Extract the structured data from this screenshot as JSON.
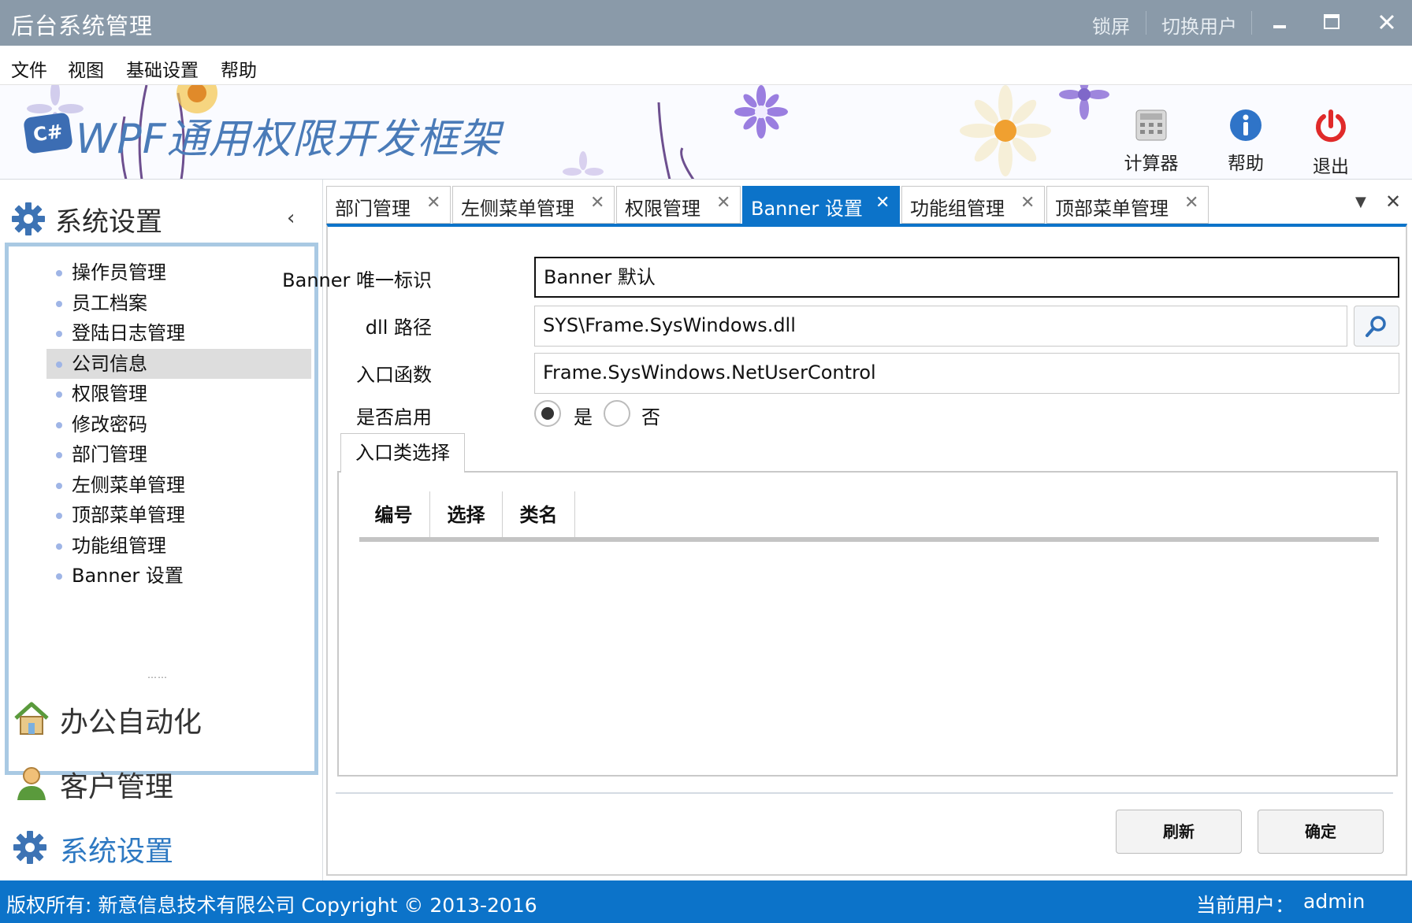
{
  "window": {
    "title": "后台系统管理",
    "lock_screen": "锁屏",
    "switch_user": "切换用户"
  },
  "menu": [
    "文件",
    "视图",
    "基础设置",
    "帮助"
  ],
  "banner": {
    "title": "WPF通用权限开发框架",
    "logo_text": "C#",
    "buttons": [
      {
        "label": "计算器",
        "icon": "calculator-icon"
      },
      {
        "label": "帮助",
        "icon": "info-icon"
      },
      {
        "label": "退出",
        "icon": "power-icon"
      }
    ]
  },
  "sidebar": {
    "header": "系统设置",
    "tree": [
      "操作员管理",
      "员工档案",
      "登陆日志管理",
      "公司信息",
      "权限管理",
      "修改密码",
      "部门管理",
      "左侧菜单管理",
      "顶部菜单管理",
      "功能组管理",
      "Banner 设置"
    ],
    "selected_index": 3,
    "accordion": [
      {
        "label": "办公自动化",
        "icon": "home-icon"
      },
      {
        "label": "客户管理",
        "icon": "user-icon"
      },
      {
        "label": "系统设置",
        "icon": "gear-icon"
      }
    ]
  },
  "tabs": [
    {
      "label": "部门管理"
    },
    {
      "label": "左侧菜单管理"
    },
    {
      "label": "权限管理"
    },
    {
      "label": "Banner 设置",
      "active": true
    },
    {
      "label": "功能组管理"
    },
    {
      "label": "顶部菜单管理"
    }
  ],
  "form": {
    "banner_id_label": "Banner 唯一标识",
    "banner_id_value": "Banner 默认",
    "dll_path_label": "dll 路径",
    "dll_path_value": "SYS\\Frame.SysWindows.dll",
    "entry_label": "入口函数",
    "entry_value": "Frame.SysWindows.NetUserControl",
    "enabled_label": "是否启用",
    "yes": "是",
    "no": "否",
    "enabled": true,
    "group_tab": "入口类选择",
    "columns": [
      "编号",
      "选择",
      "类名"
    ],
    "refresh": "刷新",
    "ok": "确定"
  },
  "status": {
    "copyright": "版权所有: 新意信息技术有限公司 Copyright © 2013-2016",
    "user_label": "当前用户：",
    "user": "admin"
  },
  "colors": {
    "accent": "#0c73c9",
    "titlebar": "#8a9aa9",
    "tree_border": "#a9c9e3"
  }
}
